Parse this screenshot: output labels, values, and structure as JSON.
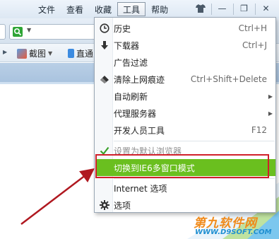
{
  "menubar": {
    "items": [
      {
        "label": "文件",
        "active": false
      },
      {
        "label": "查看",
        "active": false
      },
      {
        "label": "收藏",
        "active": false
      },
      {
        "label": "工具",
        "active": true
      },
      {
        "label": "帮助",
        "active": false
      }
    ]
  },
  "window_buttons": {
    "shirt_icon": "skin-icon",
    "minimize": "—",
    "restore": "❐",
    "close": "✕"
  },
  "toolbar": {
    "screenshot_label": "截图",
    "direct_label": "直通"
  },
  "tools_menu": {
    "items": [
      {
        "icon": "history-icon",
        "label": "历史",
        "shortcut": "Ctrl+H",
        "submenu": false,
        "disabled": false,
        "highlight": false
      },
      {
        "icon": "download-icon",
        "label": "下载器",
        "shortcut": "Ctrl+J",
        "submenu": false,
        "disabled": false,
        "highlight": false
      },
      {
        "icon": "",
        "label": "广告过滤",
        "shortcut": "",
        "submenu": false,
        "disabled": false,
        "highlight": false
      },
      {
        "icon": "eraser-icon",
        "label": "清除上网痕迹",
        "shortcut": "Ctrl+Shift+Delete",
        "submenu": false,
        "disabled": false,
        "highlight": false
      },
      {
        "icon": "",
        "label": "自动刷新",
        "shortcut": "",
        "submenu": true,
        "disabled": false,
        "highlight": false
      },
      {
        "icon": "",
        "label": "代理服务器",
        "shortcut": "",
        "submenu": true,
        "disabled": false,
        "highlight": false
      },
      {
        "icon": "",
        "label": "开发人员工具",
        "shortcut": "F12",
        "submenu": false,
        "disabled": false,
        "highlight": false
      },
      {
        "icon": "checkmark-icon",
        "label": "设置为默认浏览器",
        "shortcut": "",
        "submenu": false,
        "disabled": true,
        "highlight": false
      },
      {
        "icon": "",
        "label": "切换到IE6多窗口模式",
        "shortcut": "",
        "submenu": false,
        "disabled": false,
        "highlight": true
      },
      {
        "icon": "",
        "label": "Internet 选项",
        "shortcut": "",
        "submenu": false,
        "disabled": false,
        "highlight": false
      },
      {
        "icon": "gear-icon",
        "label": "选项",
        "shortcut": "",
        "submenu": false,
        "disabled": false,
        "highlight": false
      }
    ]
  },
  "watermark": {
    "main": "第九软件网",
    "sub": "WWW.D9SOFT.COM"
  },
  "colors": {
    "highlight": "#6abf1f",
    "annotation_red": "#d0202a",
    "watermark_orange": "#f08a1a",
    "watermark_blue": "#1f8fd1"
  }
}
